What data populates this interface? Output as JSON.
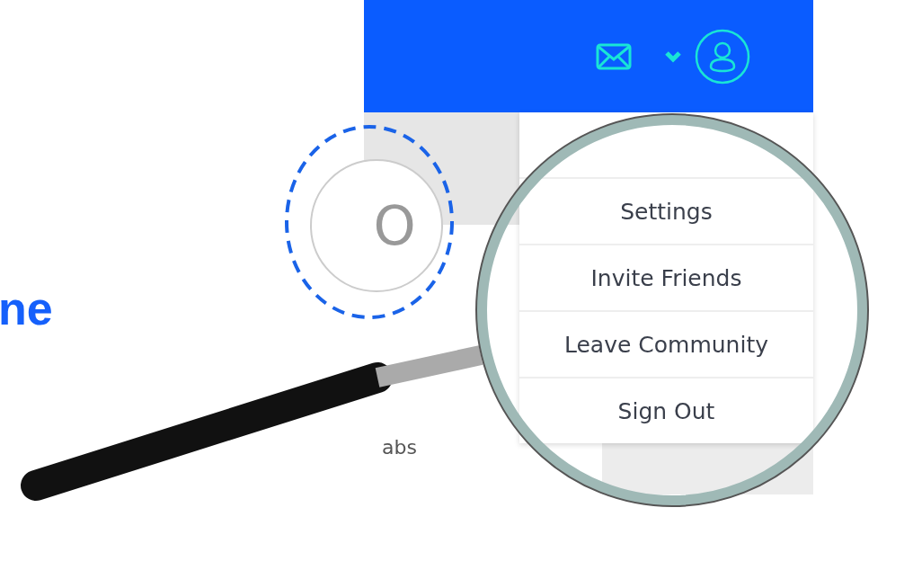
{
  "heading": "ne",
  "profile_badge": {
    "text": "O"
  },
  "card_text": "abs",
  "menu": {
    "items": [
      "Settings",
      "Invite Friends",
      "Leave Community",
      "Sign Out"
    ]
  }
}
